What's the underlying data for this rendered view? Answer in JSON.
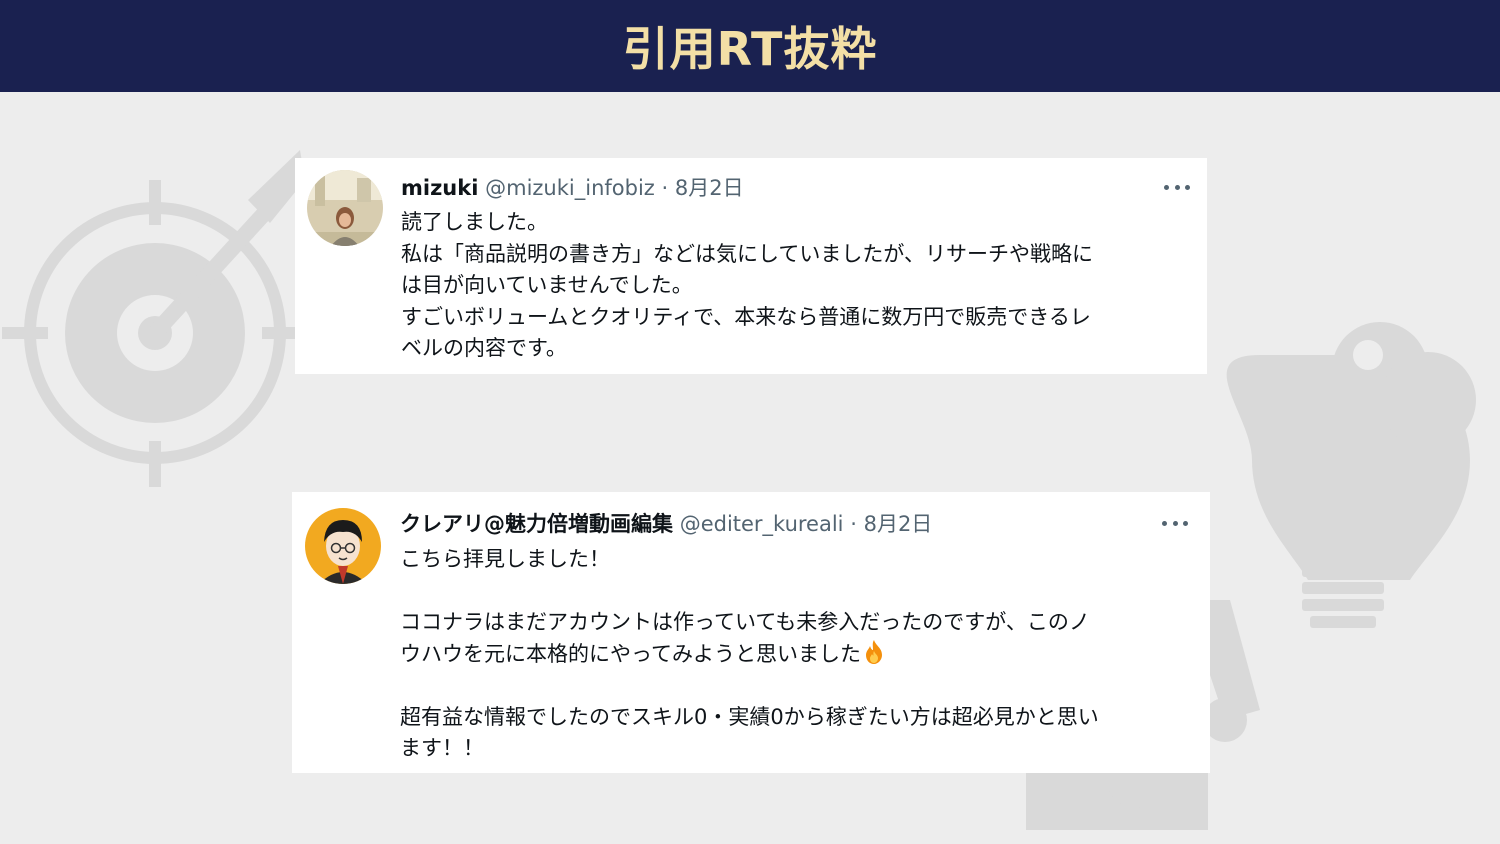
{
  "header": {
    "title": "引用RT抜粋"
  },
  "colors": {
    "header_bg": "#1a2150",
    "header_text": "#f3dfa6",
    "page_bg": "#ededed",
    "card_bg": "#ffffff",
    "muted_text": "#536471"
  },
  "tweets": [
    {
      "display_name": "mizuki",
      "handle": "@mizuki_infobiz",
      "separator": "·",
      "date": "8月2日",
      "more_icon": "ellipsis-icon",
      "lines": [
        "読了しました。",
        "私は「商品説明の書き方」などは気にしていましたが、リサーチや戦略に",
        "は目が向いていませんでした。",
        "すごいボリュームとクオリティで、本来なら普通に数万円で販売できるレ",
        "ベルの内容です。"
      ]
    },
    {
      "display_name": "クレアリ@魅力倍増動画編集",
      "handle": "@editer_kureali",
      "separator": "·",
      "date": "8月2日",
      "more_icon": "ellipsis-icon",
      "lines": [
        "こちら拝見しました！",
        "",
        "ココナラはまだアカウントは作っていても未参入だったのですが、このノ",
        "ウハウを元に本格的にやってみようと思いました",
        "",
        "超有益な情報でしたのでスキル0・実績0から稼ぎたい方は超必見かと思い",
        "ます！！"
      ],
      "emoji": "fire-emoji-icon"
    }
  ],
  "background_icons": [
    "target-arrow-icon",
    "lightbulb-puzzle-icon"
  ]
}
